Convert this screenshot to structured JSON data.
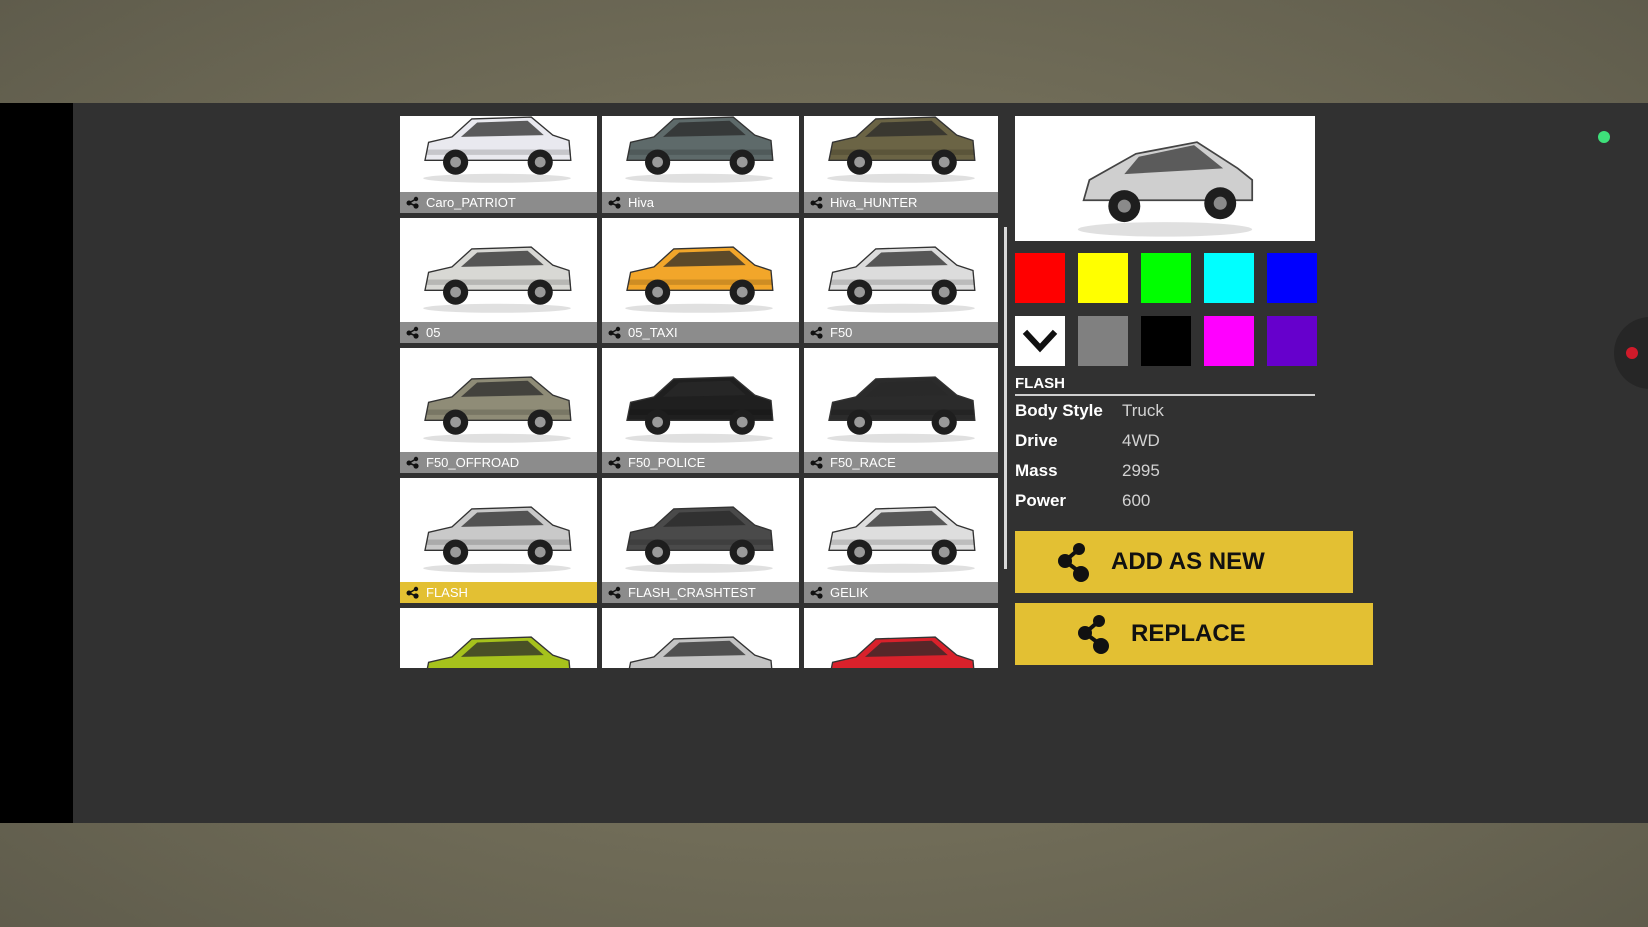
{
  "vehicles": [
    {
      "name": "Caro_PATRIOT",
      "icon": "share-icon",
      "color": "#e9e9ef",
      "selected": false
    },
    {
      "name": "Hiva",
      "icon": "share-icon",
      "color": "#5e6a6a",
      "selected": false
    },
    {
      "name": "Hiva_HUNTER",
      "icon": "share-icon",
      "color": "#6b6445",
      "selected": false
    },
    {
      "name": "05",
      "icon": "share-icon",
      "color": "#d8d8d4",
      "selected": false
    },
    {
      "name": "05_TAXI",
      "icon": "share-icon",
      "color": "#f2a62a",
      "selected": false
    },
    {
      "name": "F50",
      "icon": "share-icon",
      "color": "#dcdcdc",
      "selected": false
    },
    {
      "name": "F50_OFFROAD",
      "icon": "share-icon",
      "color": "#8f8c77",
      "selected": false
    },
    {
      "name": "F50_POLICE",
      "icon": "share-icon",
      "color": "#1f1f1f",
      "selected": false
    },
    {
      "name": "F50_RACE",
      "icon": "share-icon",
      "color": "#2b2b2b",
      "selected": false
    },
    {
      "name": "FLASH",
      "icon": "share-icon",
      "color": "#c9c9c9",
      "selected": true
    },
    {
      "name": "FLASH_CRASHTEST",
      "icon": "share-icon",
      "color": "#4a4a4a",
      "selected": false
    },
    {
      "name": "GELIK",
      "icon": "share-icon",
      "color": "#dedede",
      "selected": false
    },
    {
      "name": "",
      "icon": "",
      "color": "#a6c21c",
      "selected": false
    },
    {
      "name": "",
      "icon": "",
      "color": "#c4c4c4",
      "selected": false
    },
    {
      "name": "",
      "icon": "",
      "color": "#d9212b",
      "selected": false
    }
  ],
  "preview": {
    "vehicle": "FLASH",
    "color": "#cfcfcf"
  },
  "colors": [
    "#ff0000",
    "#ffff00",
    "#00ff00",
    "#00ffff",
    "#0000ff",
    "#ffffff",
    "#808080",
    "#000000",
    "#ff00ff",
    "#6600cc"
  ],
  "selected_color_index": 5,
  "selected_color_icon": "chevron-down-icon",
  "info": {
    "name": "FLASH",
    "body_style_label": "Body Style",
    "body_style": "Truck",
    "drive_label": "Drive",
    "drive": "4WD",
    "mass_label": "Mass",
    "mass": "2995",
    "power_label": "Power",
    "power": "600"
  },
  "buttons": {
    "add_as_new": "ADD AS NEW",
    "replace": "REPLACE",
    "icon": "share-icon"
  },
  "status": {
    "indicator_color": "#3ee07a",
    "handle_dot_color": "#d01a2a"
  }
}
